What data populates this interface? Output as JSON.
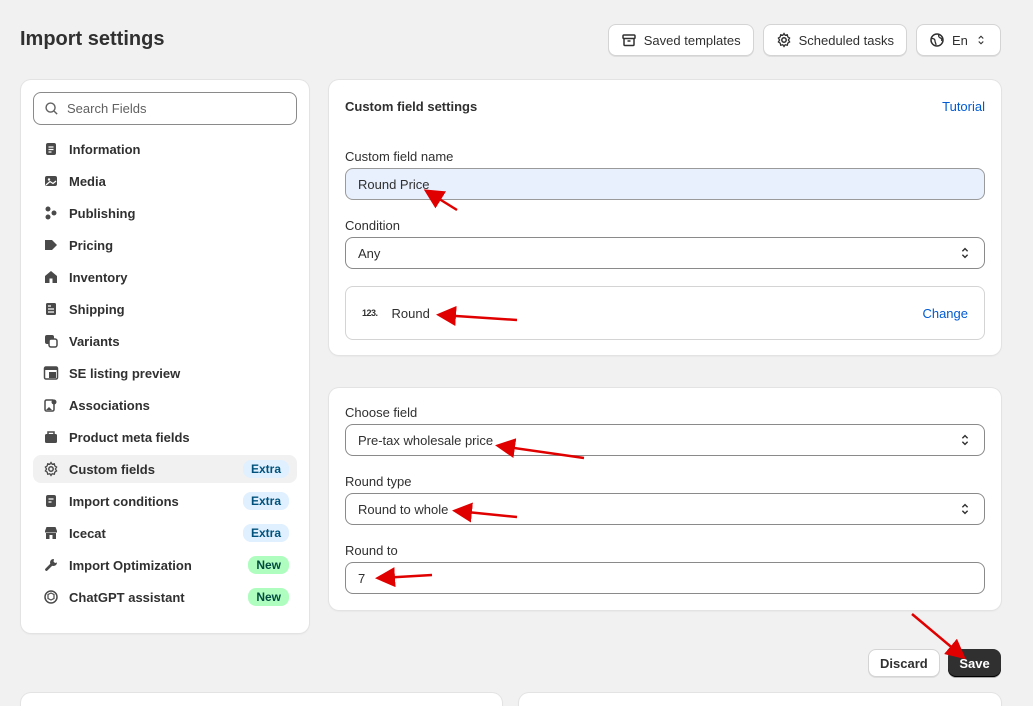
{
  "page": {
    "title": "Import settings"
  },
  "top_actions": {
    "saved_templates": "Saved templates",
    "scheduled_tasks": "Scheduled tasks",
    "language": "En"
  },
  "sidebar": {
    "search_placeholder": "Search Fields",
    "items": [
      {
        "label": "Information",
        "icon": "document-icon",
        "badge": ""
      },
      {
        "label": "Media",
        "icon": "image-icon",
        "badge": ""
      },
      {
        "label": "Publishing",
        "icon": "channels-icon",
        "badge": ""
      },
      {
        "label": "Pricing",
        "icon": "price-tag-icon",
        "badge": ""
      },
      {
        "label": "Inventory",
        "icon": "store-icon",
        "badge": ""
      },
      {
        "label": "Shipping",
        "icon": "package-icon",
        "badge": ""
      },
      {
        "label": "Variants",
        "icon": "variants-icon",
        "badge": ""
      },
      {
        "label": "SE listing preview",
        "icon": "listing-icon",
        "badge": ""
      },
      {
        "label": "Associations",
        "icon": "associations-icon",
        "badge": ""
      },
      {
        "label": "Product meta fields",
        "icon": "metafields-icon",
        "badge": ""
      },
      {
        "label": "Custom fields",
        "icon": "gear-icon",
        "badge": "Extra",
        "active": true
      },
      {
        "label": "Import conditions",
        "icon": "conditions-icon",
        "badge": "Extra"
      },
      {
        "label": "Icecat",
        "icon": "icecat-store-icon",
        "badge": "Extra"
      },
      {
        "label": "Import Optimization",
        "icon": "wrench-icon",
        "badge": "New"
      },
      {
        "label": "ChatGPT assistant",
        "icon": "chatgpt-icon",
        "badge": "New"
      }
    ]
  },
  "custom_field_settings": {
    "title": "Custom field settings",
    "tutorial_link": "Tutorial",
    "name_label": "Custom field name",
    "name_value": "Round Price",
    "condition_label": "Condition",
    "condition_value": "Any",
    "function_icon": "123.",
    "function_name": "Round",
    "change_link": "Change"
  },
  "round_settings": {
    "choose_field_label": "Choose field",
    "choose_field_value": "Pre-tax wholesale price",
    "round_type_label": "Round type",
    "round_type_value": "Round to whole",
    "round_to_label": "Round to",
    "round_to_value": "7"
  },
  "footer": {
    "discard": "Discard",
    "save": "Save"
  },
  "colors": {
    "annotation_arrow": "#e00000",
    "link": "#005bd3",
    "primary_button": "#303030"
  }
}
